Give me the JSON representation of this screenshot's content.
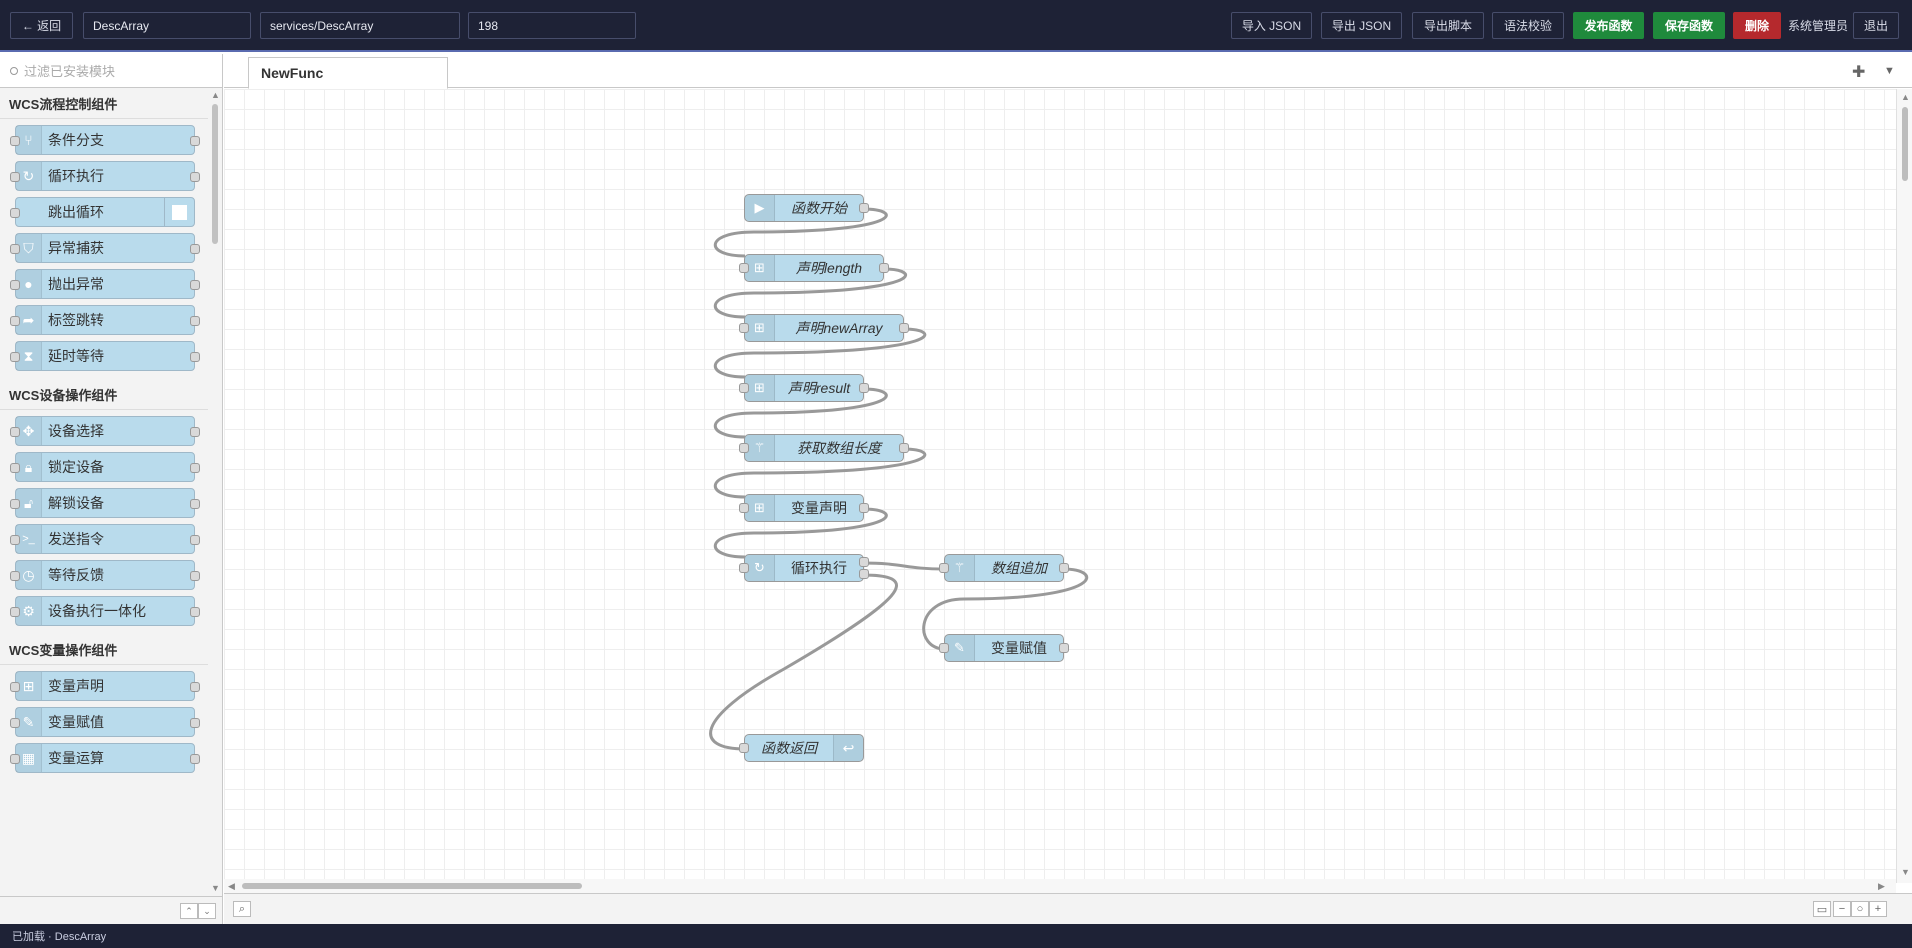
{
  "header": {
    "back_label": "← 返回",
    "func_name": "DescArray",
    "func_path": "services/DescArray",
    "func_id": "198",
    "import_json": "导入 JSON",
    "export_json": "导出 JSON",
    "export_script": "导出脚本",
    "syntax_check": "语法校验",
    "publish": "发布函数",
    "save": "保存函数",
    "delete": "删除",
    "user": "系统管理员",
    "logout": "退出"
  },
  "palette": {
    "search_placeholder": "过滤已安装模块",
    "categories": [
      {
        "title": "WCS流程控制组件",
        "items": [
          "条件分支",
          "循环执行",
          "跳出循环",
          "异常捕获",
          "抛出异常",
          "标签跳转",
          "延时等待"
        ]
      },
      {
        "title": "WCS设备操作组件",
        "items": [
          "设备选择",
          "锁定设备",
          "解锁设备",
          "发送指令",
          "等待反馈",
          "设备执行一体化"
        ]
      },
      {
        "title": "WCS变量操作组件",
        "items": [
          "变量声明",
          "变量赋值",
          "变量运算"
        ]
      }
    ]
  },
  "workspace": {
    "tab_label": "NewFunc",
    "nodes": {
      "start": "函数开始",
      "decl_length": "声明length",
      "decl_newarray": "声明newArray",
      "decl_result": "声明result",
      "get_length": "获取数组长度",
      "var_decl": "变量声明",
      "loop": "循环执行",
      "array_push": "数组追加",
      "var_assign": "变量赋值",
      "func_return": "函数返回"
    }
  },
  "statusbar": {
    "text": "已加载 · DescArray"
  },
  "colors": {
    "header_bg": "#1e2236",
    "node_fill": "#b9dbec",
    "publish_green": "#1f8a3c",
    "delete_red": "#b5292d"
  }
}
